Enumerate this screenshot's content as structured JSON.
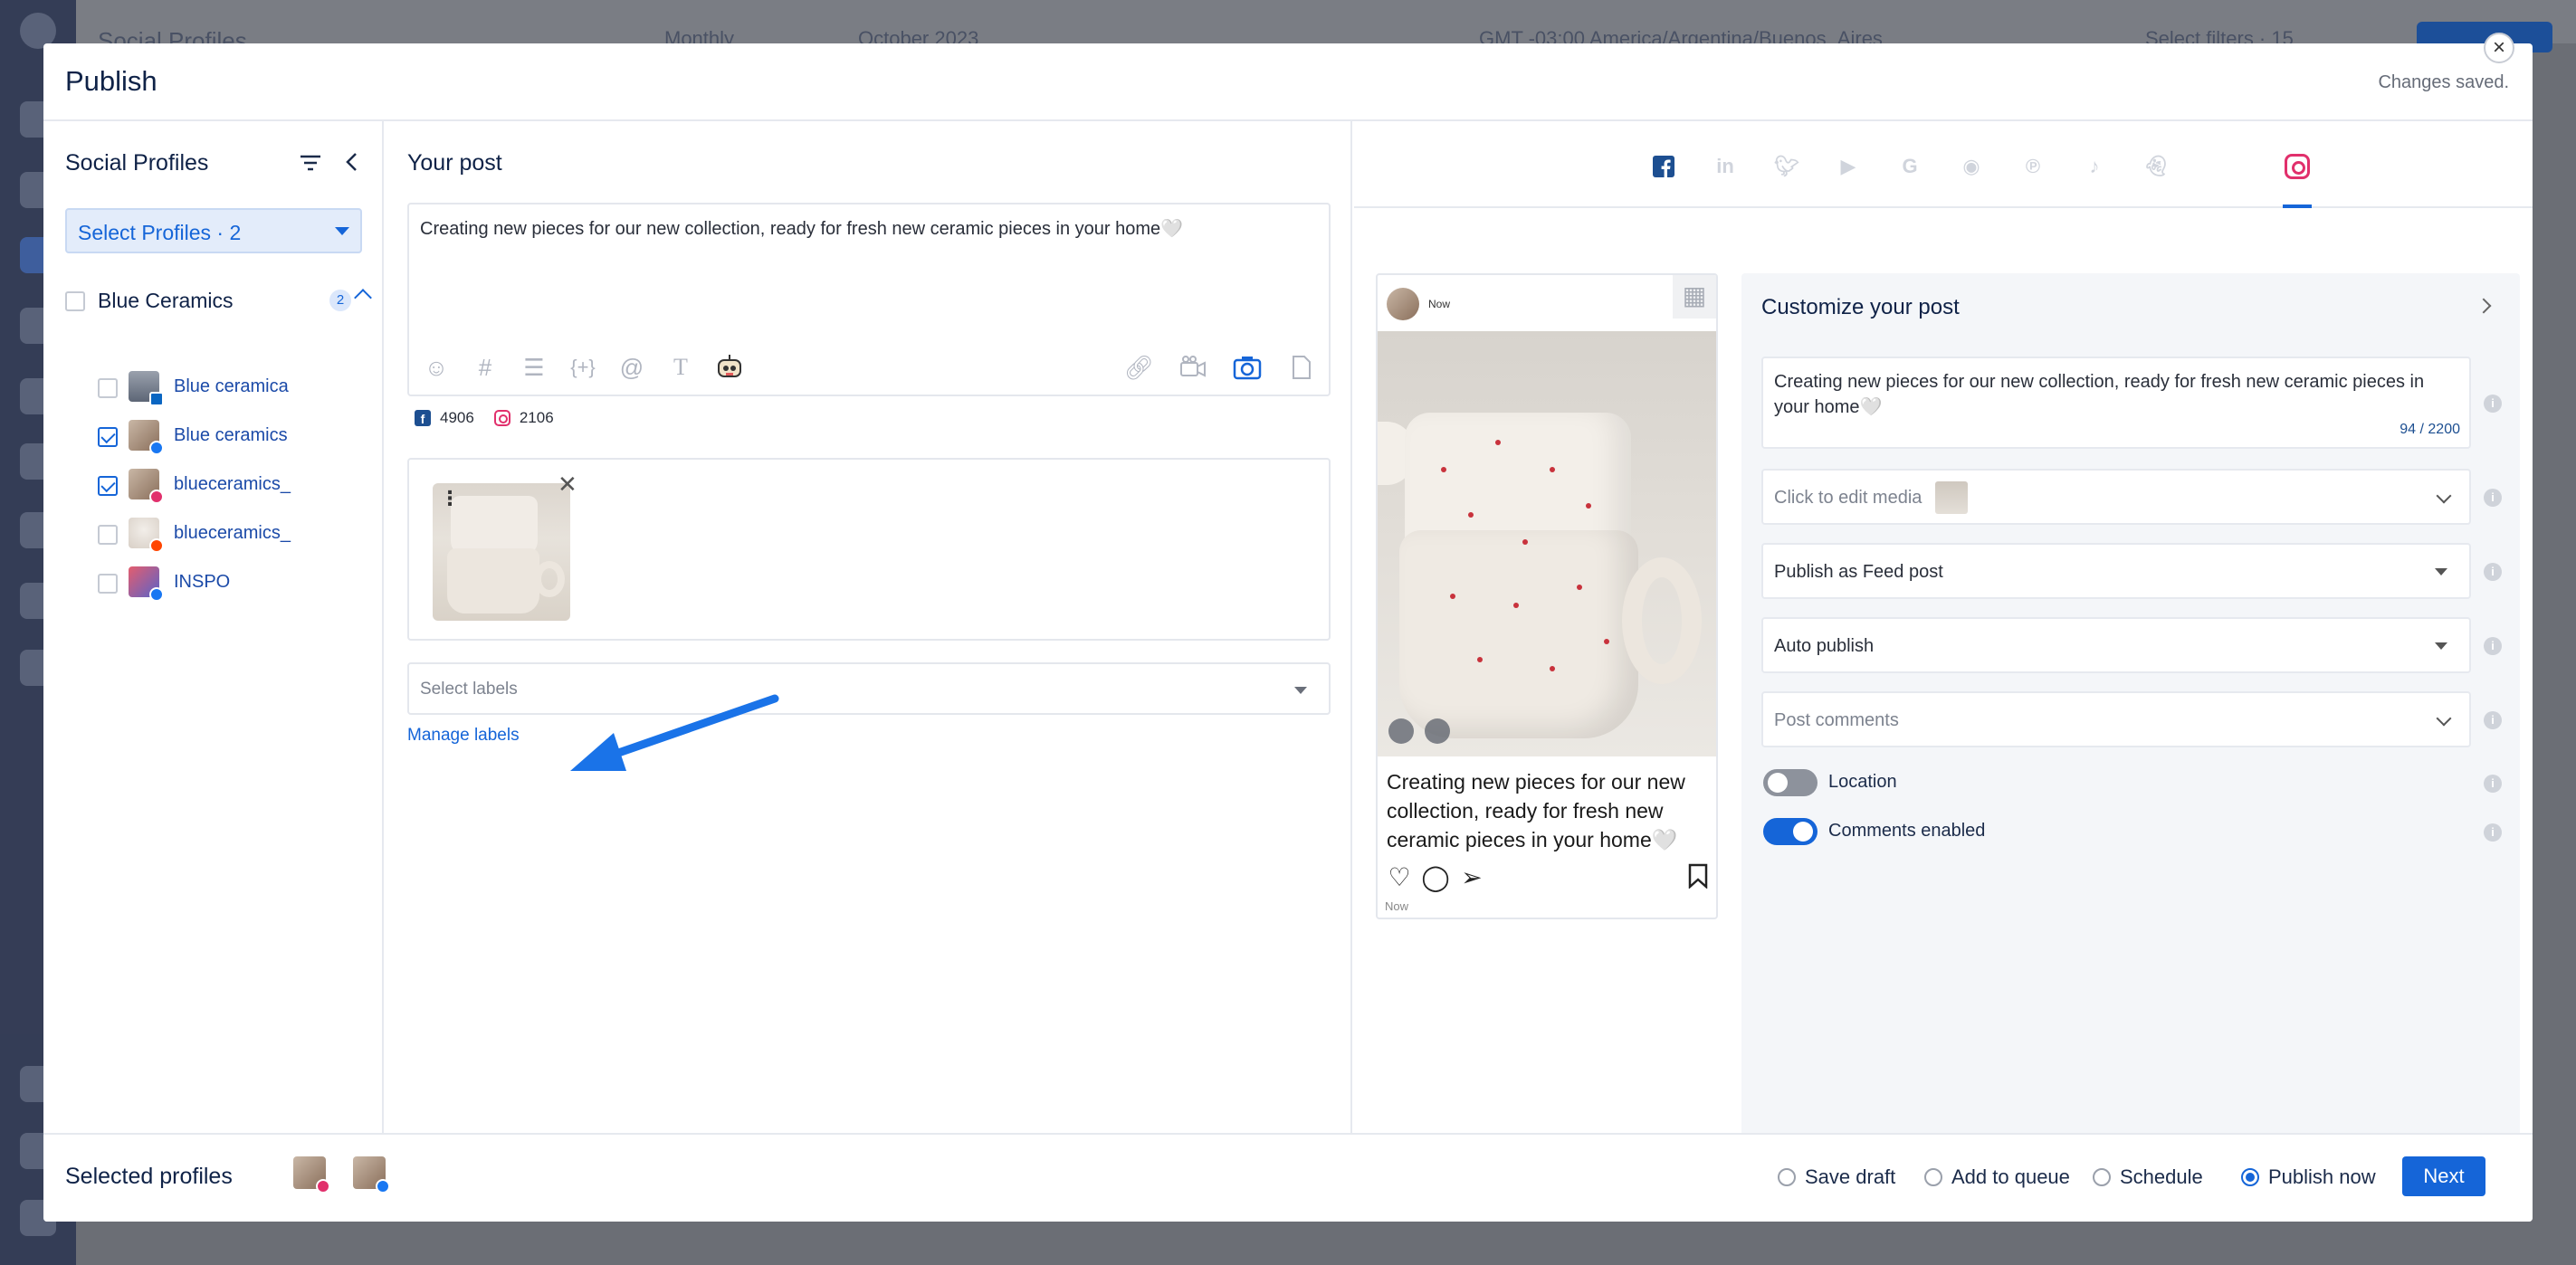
{
  "background": {
    "top_left_text": "Social Profiles",
    "view_mode": "Monthly",
    "period": "October 2023",
    "timezone": "GMT -03:00 America/Argentina/Buenos_Aires",
    "filters": "Select filters · 15"
  },
  "modal": {
    "title": "Publish",
    "status": "Changes saved.",
    "close_glyph": "×"
  },
  "left": {
    "title": "Social Profiles",
    "select_label": "Select Profiles · 2",
    "group": {
      "name": "Blue Ceramics",
      "count": "2",
      "checked": false
    },
    "profiles": [
      {
        "name": "Blue ceramica",
        "network": "linkedin",
        "checked": false
      },
      {
        "name": "Blue ceramics",
        "network": "facebook",
        "checked": true
      },
      {
        "name": "blueceramics_",
        "network": "instagram",
        "checked": true
      },
      {
        "name": "blueceramics_",
        "network": "reddit",
        "checked": false
      },
      {
        "name": "INSPO",
        "network": "facebook",
        "checked": false
      }
    ]
  },
  "post": {
    "title": "Your post",
    "text": "Creating new pieces for our new collection, ready for fresh new ceramic pieces in your home🤍",
    "toolbar_left": [
      "emoji-icon",
      "hashtag-icon",
      "text-block-icon",
      "variable-icon",
      "mention-icon",
      "text-format-icon",
      "robot-icon"
    ],
    "toolbar_right": [
      "link-icon",
      "video-icon",
      "camera-icon",
      "document-icon"
    ],
    "fb_count": "4906",
    "ig_count": "2106",
    "labels_placeholder": "Select labels",
    "manage_labels": "Manage labels"
  },
  "networks": [
    "facebook",
    "instagram",
    "linkedin",
    "twitter",
    "youtube",
    "google",
    "reddit",
    "pinterest",
    "tiktok",
    "snapchat"
  ],
  "active_network": "instagram",
  "preview": {
    "time_top": "Now",
    "caption": "Creating new pieces for our new collection, ready for fresh new ceramic pieces in your home🤍",
    "time_bottom": "Now"
  },
  "customize": {
    "title": "Customize your post",
    "caption": "Creating new pieces for our new collection, ready for fresh new ceramic pieces in your home🤍",
    "char_count": "94 / 2200",
    "media_label": "Click to edit media",
    "publish_as": "Publish as Feed post",
    "publish_mode": "Auto publish",
    "comments_placeholder": "Post comments",
    "location_label": "Location",
    "location_on": false,
    "comments_label": "Comments enabled",
    "comments_on": true,
    "info_glyph": "i"
  },
  "footer": {
    "selected_label": "Selected profiles",
    "options": [
      {
        "label": "Save draft",
        "selected": false
      },
      {
        "label": "Add to queue",
        "selected": false
      },
      {
        "label": "Schedule",
        "selected": false
      },
      {
        "label": "Publish now",
        "selected": true
      }
    ],
    "next_label": "Next"
  },
  "colors": {
    "accent": "#1565d8",
    "heading": "#0f2247",
    "instagram": "#e1306c",
    "facebook": "#1d4f91",
    "arrow": "#1a73e8"
  }
}
